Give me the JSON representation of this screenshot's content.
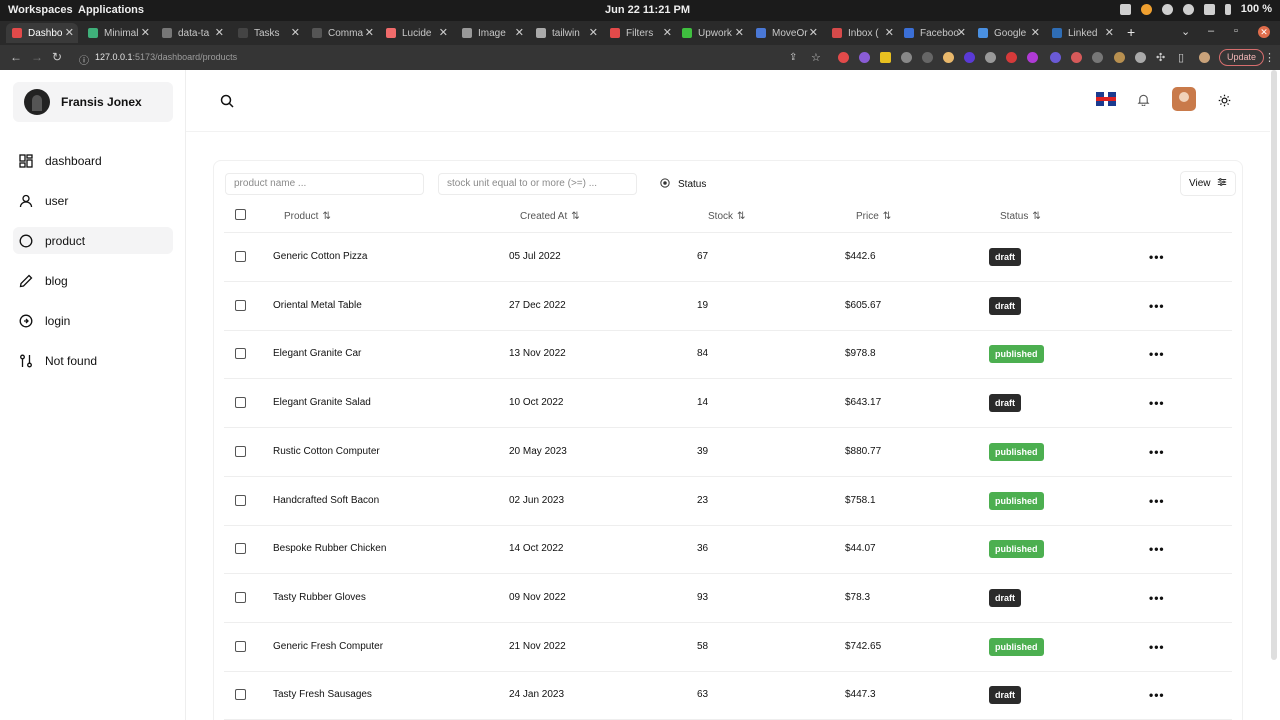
{
  "os": {
    "workspaces": "Workspaces",
    "applications": "Applications",
    "clock": "Jun 22  11:21 PM",
    "battery": "100 %"
  },
  "browser": {
    "tabs": [
      {
        "title": "Dashbo",
        "color": "#e24a4a"
      },
      {
        "title": "Minimal",
        "color": "#3fb07a"
      },
      {
        "title": "data-ta",
        "color": "#777777"
      },
      {
        "title": "Tasks",
        "color": "#444444"
      },
      {
        "title": "Comma",
        "color": "#555555"
      },
      {
        "title": "Lucide",
        "color": "#f06b6b"
      },
      {
        "title": "Image",
        "color": "#999999"
      },
      {
        "title": "tailwin",
        "color": "#aaaaaa"
      },
      {
        "title": "Filters",
        "color": "#e24a4a"
      },
      {
        "title": "Upwork",
        "color": "#3fbf3f"
      },
      {
        "title": "MoveOr",
        "color": "#4a78d6"
      },
      {
        "title": "Inbox (",
        "color": "#d64a4a"
      },
      {
        "title": "Faceboo",
        "color": "#3b6fd6"
      },
      {
        "title": "Google",
        "color": "#4a90e2"
      },
      {
        "title": "Linked",
        "color": "#2f6db5"
      }
    ],
    "url_host": "127.0.0.1",
    "url_path": ":5173/dashboard/products",
    "update_label": "Update"
  },
  "sidebar": {
    "user_name": "Fransis Jonex",
    "items": [
      {
        "label": "dashboard",
        "icon": "dashboard-icon"
      },
      {
        "label": "user",
        "icon": "user-icon"
      },
      {
        "label": "product",
        "icon": "product-icon"
      },
      {
        "label": "blog",
        "icon": "pencil-icon"
      },
      {
        "label": "login",
        "icon": "login-icon"
      },
      {
        "label": "Not found",
        "icon": "not-found-icon"
      }
    ]
  },
  "filters": {
    "product_placeholder": "product name ...",
    "stock_placeholder": "stock unit equal to or more (>=) ...",
    "status_label": "Status",
    "view_label": "View"
  },
  "table": {
    "headers": [
      "Product",
      "Created At",
      "Stock",
      "Price",
      "Status"
    ],
    "rows": [
      {
        "product": "Generic Cotton Pizza",
        "created": "05 Jul 2022",
        "stock": "67",
        "price": "$442.6",
        "status": "draft"
      },
      {
        "product": "Oriental Metal Table",
        "created": "27 Dec 2022",
        "stock": "19",
        "price": "$605.67",
        "status": "draft"
      },
      {
        "product": "Elegant Granite Car",
        "created": "13 Nov 2022",
        "stock": "84",
        "price": "$978.8",
        "status": "published"
      },
      {
        "product": "Elegant Granite Salad",
        "created": "10 Oct 2022",
        "stock": "14",
        "price": "$643.17",
        "status": "draft"
      },
      {
        "product": "Rustic Cotton Computer",
        "created": "20 May 2023",
        "stock": "39",
        "price": "$880.77",
        "status": "published"
      },
      {
        "product": "Handcrafted Soft Bacon",
        "created": "02 Jun 2023",
        "stock": "23",
        "price": "$758.1",
        "status": "published"
      },
      {
        "product": "Bespoke Rubber Chicken",
        "created": "14 Oct 2022",
        "stock": "36",
        "price": "$44.07",
        "status": "published"
      },
      {
        "product": "Tasty Rubber Gloves",
        "created": "09 Nov 2022",
        "stock": "93",
        "price": "$78.3",
        "status": "draft"
      },
      {
        "product": "Generic Fresh Computer",
        "created": "21 Nov 2022",
        "stock": "58",
        "price": "$742.65",
        "status": "published"
      },
      {
        "product": "Tasty Fresh Sausages",
        "created": "24 Jan 2023",
        "stock": "63",
        "price": "$447.3",
        "status": "draft"
      }
    ]
  }
}
